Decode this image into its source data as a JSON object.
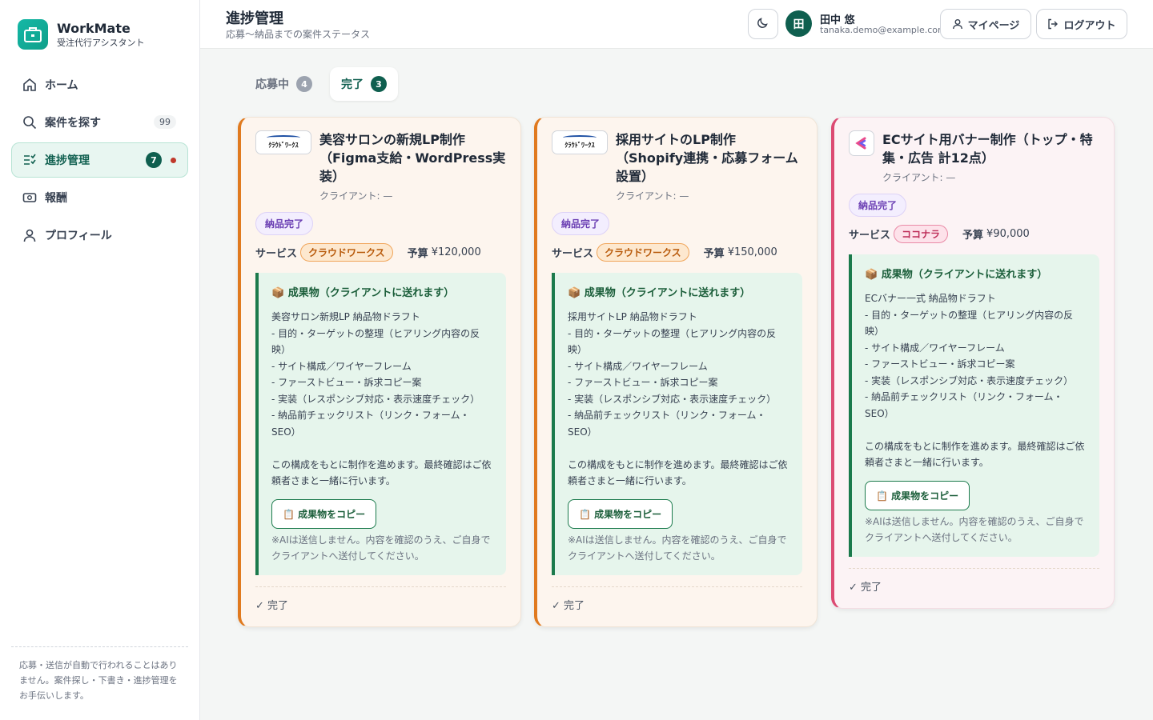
{
  "app": {
    "name": "WorkMate",
    "subtitle": "受注代行アシスタント"
  },
  "sidebar": {
    "items": [
      {
        "label": "ホーム",
        "icon": "home-icon"
      },
      {
        "label": "案件を探す",
        "icon": "search-icon",
        "count": "99"
      },
      {
        "label": "進捗管理",
        "icon": "progress-list-icon",
        "badge": "7",
        "active": true
      },
      {
        "label": "報酬",
        "icon": "money-icon"
      },
      {
        "label": "プロフィール",
        "icon": "user-icon"
      }
    ],
    "note": "応募・送信が自動で行われることはありません。案件探し・下書き・進捗管理をお手伝いします。"
  },
  "header": {
    "title": "進捗管理",
    "subtitle": "応募〜納品までの案件ステータス",
    "user": {
      "initial": "田",
      "name": "田中 悠",
      "email": "tanaka.demo@example.com"
    },
    "mypage_label": "マイページ",
    "logout_label": "ログアウト"
  },
  "tabs": [
    {
      "label": "応募中",
      "count": "4"
    },
    {
      "label": "完了",
      "count": "3",
      "active": true
    }
  ],
  "colors": {
    "accent": "#0f5f4f",
    "crowdworks": "#e07a1f",
    "coconala": "#dc4a72",
    "deliverable": "#1b7a4c"
  },
  "cards": [
    {
      "title": "美容サロンの新規LP制作（Figma支給・WordPress実装）",
      "client": "クライアント: —",
      "status": "納品完了",
      "service_label": "サービス",
      "service": "クラウドワークス",
      "budget_label": "予算",
      "budget": "¥120,000",
      "deliverable_title": "📦 成果物（クライアントに送れます）",
      "deliverable_body": "美容サロン新規LP 納品物ドラフト\n- 目的・ターゲットの整理（ヒアリング内容の反映）\n- サイト構成／ワイヤーフレーム\n- ファーストビュー・訴求コピー案\n- 実装（レスポンシブ対応・表示速度チェック）\n- 納品前チェックリスト（リンク・フォーム・SEO）\n\nこの構成をもとに制作を進めます。最終確認はご依頼者さまと一緒に行います。",
      "copy_label": "📋 成果物をコピー",
      "note": "※AIは送信しません。内容を確認のうえ、ご自身でクライアントへ送付してください。",
      "footer": "✓ 完了"
    },
    {
      "title": "採用サイトのLP制作（Shopify連携・応募フォーム設置）",
      "client": "クライアント: —",
      "status": "納品完了",
      "service_label": "サービス",
      "service": "クラウドワークス",
      "budget_label": "予算",
      "budget": "¥150,000",
      "deliverable_title": "📦 成果物（クライアントに送れます）",
      "deliverable_body": "採用サイトLP 納品物ドラフト\n- 目的・ターゲットの整理（ヒアリング内容の反映）\n- サイト構成／ワイヤーフレーム\n- ファーストビュー・訴求コピー案\n- 実装（レスポンシブ対応・表示速度チェック）\n- 納品前チェックリスト（リンク・フォーム・SEO）\n\nこの構成をもとに制作を進めます。最終確認はご依頼者さまと一緒に行います。",
      "copy_label": "📋 成果物をコピー",
      "note": "※AIは送信しません。内容を確認のうえ、ご自身でクライアントへ送付してください。",
      "footer": "✓ 完了"
    },
    {
      "title": "ECサイト用バナー制作（トップ・特集・広告 計12点）",
      "client": "クライアント: —",
      "status": "納品完了",
      "service_label": "サービス",
      "service": "ココナラ",
      "budget_label": "予算",
      "budget": "¥90,000",
      "deliverable_title": "📦 成果物（クライアントに送れます）",
      "deliverable_body": "ECバナー一式 納品物ドラフト\n- 目的・ターゲットの整理（ヒアリング内容の反映）\n- サイト構成／ワイヤーフレーム\n- ファーストビュー・訴求コピー案\n- 実装（レスポンシブ対応・表示速度チェック）\n- 納品前チェックリスト（リンク・フォーム・SEO）\n\nこの構成をもとに制作を進めます。最終確認はご依頼者さまと一緒に行います。",
      "copy_label": "📋 成果物をコピー",
      "note": "※AIは送信しません。内容を確認のうえ、ご自身でクライアントへ送付してください。",
      "footer": "✓ 完了"
    }
  ]
}
